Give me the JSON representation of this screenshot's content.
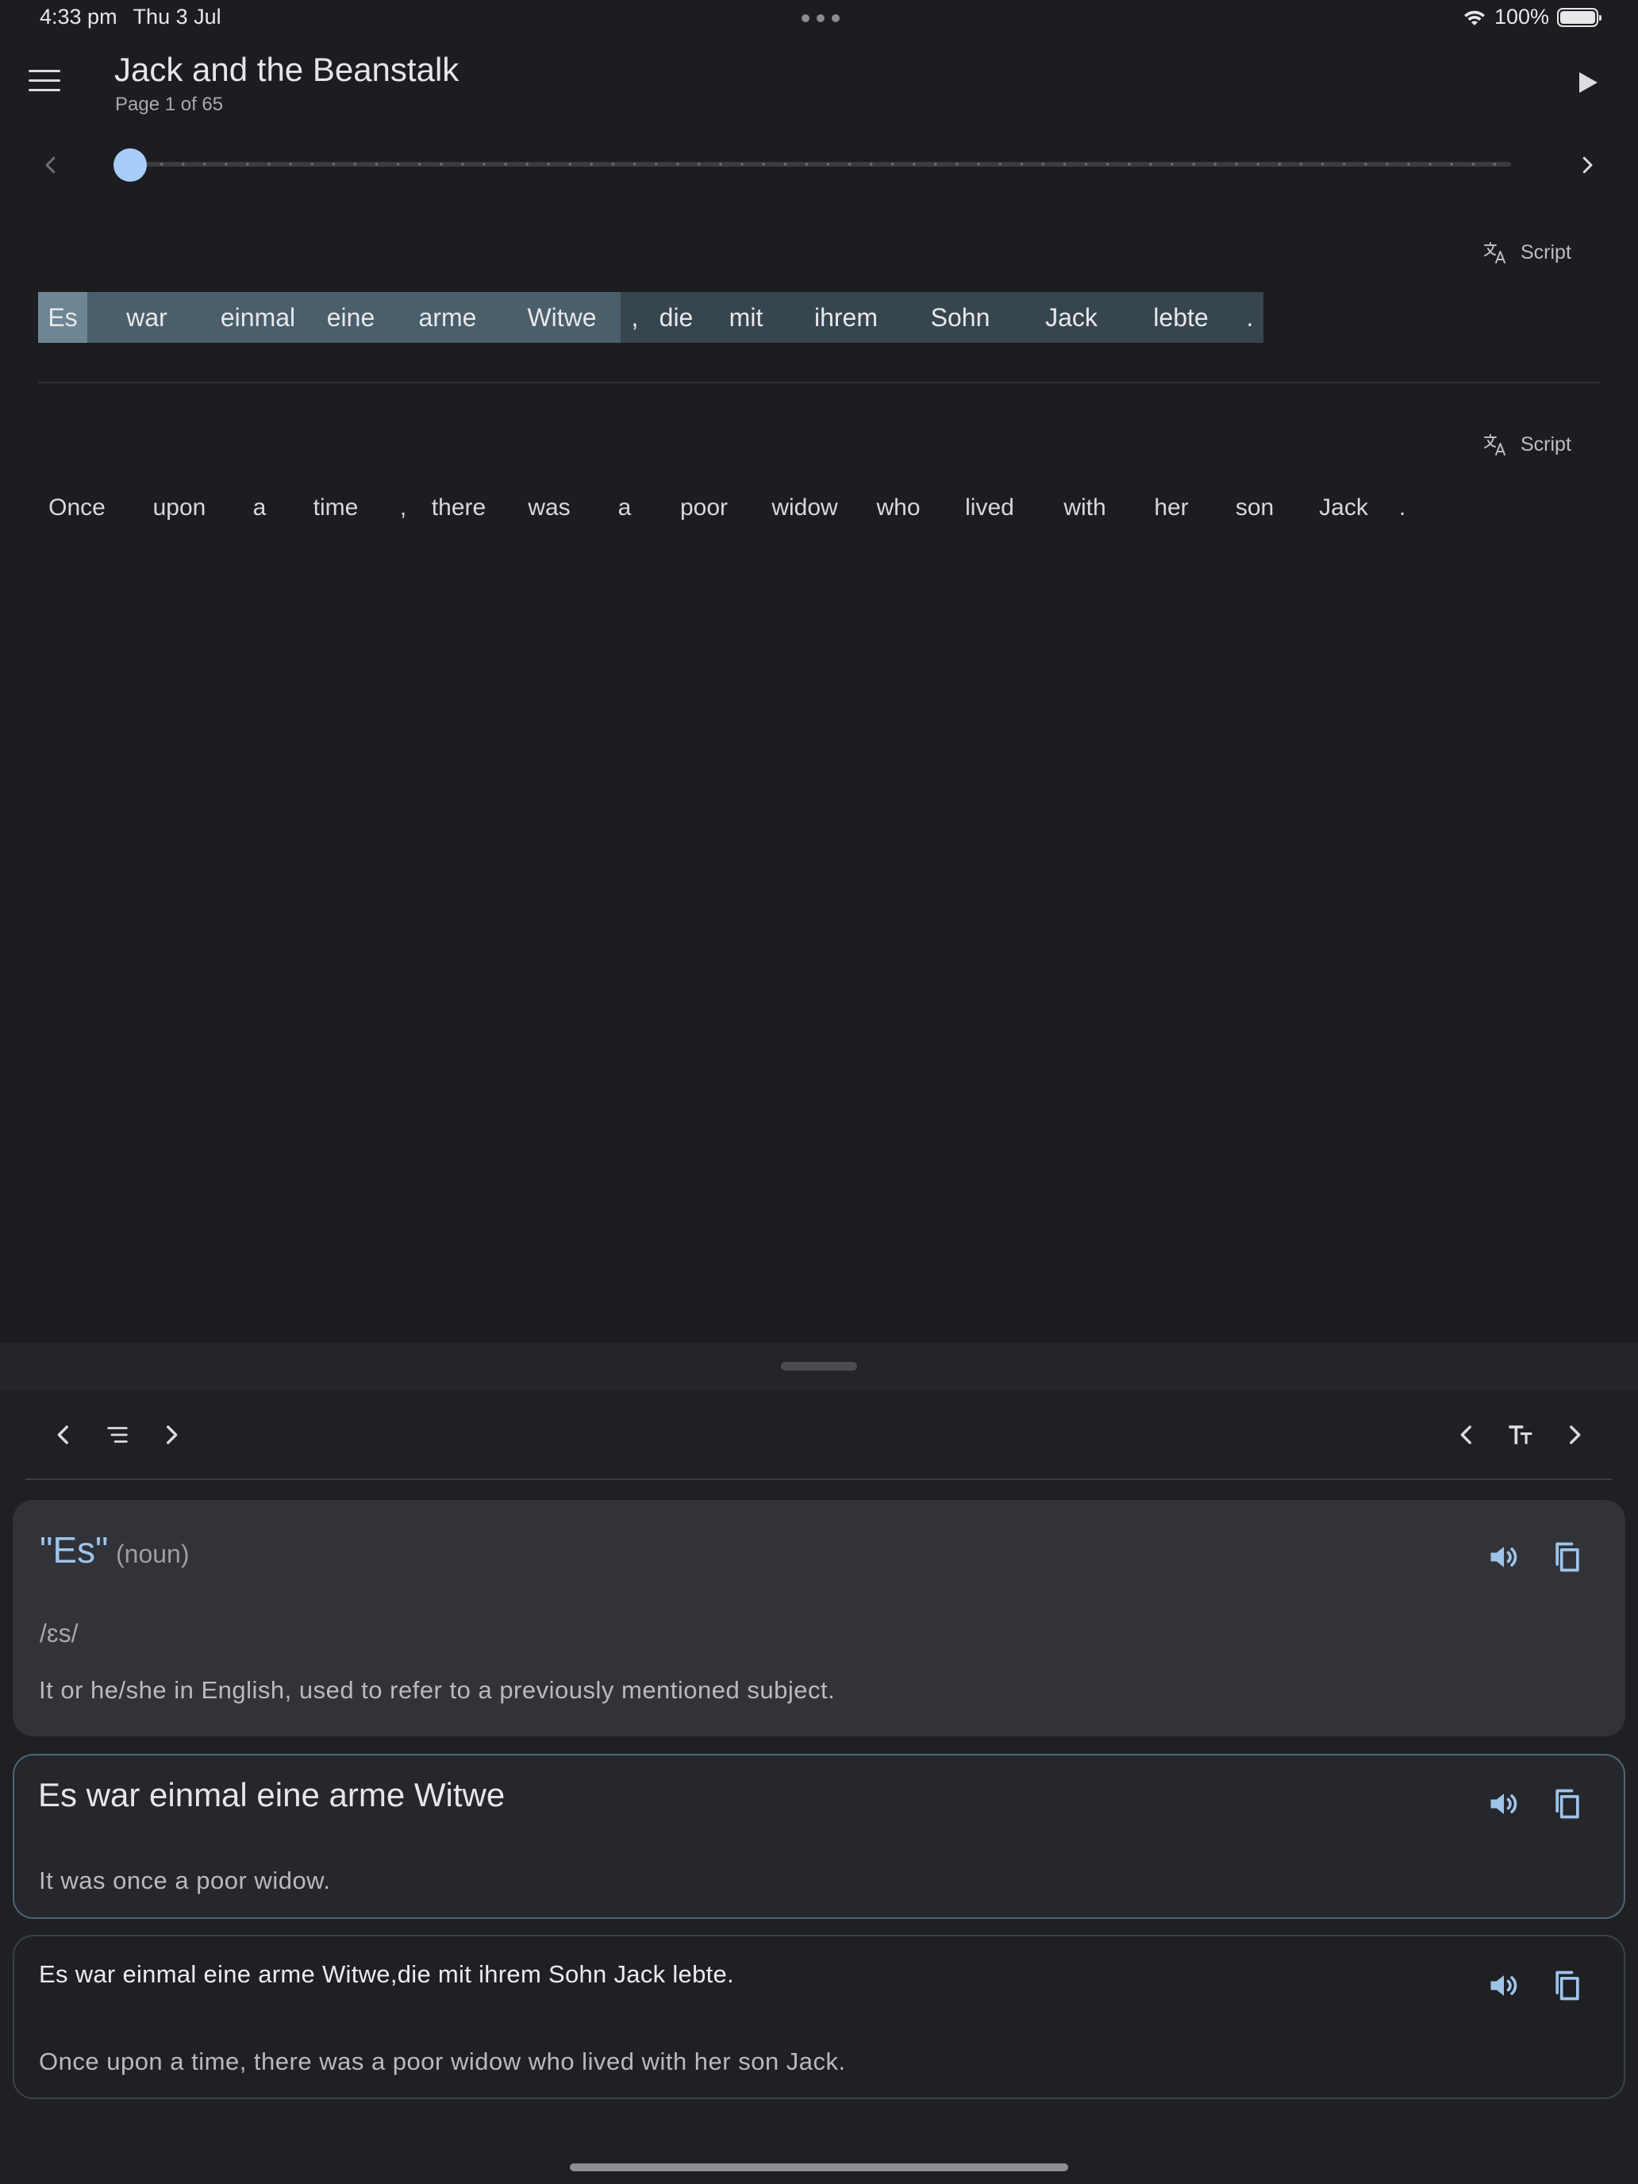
{
  "status_bar": {
    "time": "4:33 pm",
    "date": "Thu 3 Jul",
    "battery": "100%"
  },
  "header": {
    "title": "Jack and the Beanstalk",
    "page_info": "Page 1 of 65",
    "menu_icon": "menu-icon",
    "play_icon": "play-icon"
  },
  "pager": {
    "current_page": 1,
    "total_pages": 65
  },
  "original": {
    "script_label": "Script",
    "tokens": [
      {
        "text": "Es",
        "kind": "word"
      },
      {
        "text": "war",
        "kind": "word"
      },
      {
        "text": "einmal",
        "kind": "word"
      },
      {
        "text": "eine",
        "kind": "word"
      },
      {
        "text": "arme",
        "kind": "word"
      },
      {
        "text": "Witwe",
        "kind": "word"
      },
      {
        "text": ",",
        "kind": "punct"
      },
      {
        "text": "die",
        "kind": "word"
      },
      {
        "text": "mit",
        "kind": "word"
      },
      {
        "text": "ihrem",
        "kind": "word"
      },
      {
        "text": "Sohn",
        "kind": "word"
      },
      {
        "text": "Jack",
        "kind": "word"
      },
      {
        "text": "lebte",
        "kind": "word"
      },
      {
        "text": ".",
        "kind": "punct"
      }
    ]
  },
  "translation": {
    "script_label": "Script",
    "tokens": [
      {
        "text": "Once",
        "kind": "word"
      },
      {
        "text": "upon",
        "kind": "word"
      },
      {
        "text": "a",
        "kind": "word"
      },
      {
        "text": "time",
        "kind": "word"
      },
      {
        "text": ",",
        "kind": "punct"
      },
      {
        "text": "there",
        "kind": "word"
      },
      {
        "text": "was",
        "kind": "word"
      },
      {
        "text": "a",
        "kind": "word"
      },
      {
        "text": "poor",
        "kind": "word"
      },
      {
        "text": "widow",
        "kind": "word"
      },
      {
        "text": "who",
        "kind": "word"
      },
      {
        "text": "lived",
        "kind": "word"
      },
      {
        "text": "with",
        "kind": "word"
      },
      {
        "text": "her",
        "kind": "word"
      },
      {
        "text": "son",
        "kind": "word"
      },
      {
        "text": "Jack",
        "kind": "word"
      },
      {
        "text": ".",
        "kind": "punct"
      }
    ]
  },
  "word_card": {
    "word": "\"Es\"",
    "part_of_speech": "(noun)",
    "ipa": "/ɛs/",
    "definition": "It or he/she in English, used to refer to a previously mentioned subject."
  },
  "phrase_card": {
    "phrase": "Es war einmal eine arme Witwe",
    "translation": "It was once a poor widow."
  },
  "sentence_card": {
    "sentence": "Es war einmal eine arme Witwe,die mit ihrem Sohn Jack lebte.",
    "translation": "Once upon a time, there was a poor widow who lived with her son Jack."
  },
  "colors": {
    "accent": "#a8cdfa",
    "selected_word": "#6e8694",
    "selected_phrase": "#4a5e6b",
    "sentence_highlight": "#37454f"
  }
}
